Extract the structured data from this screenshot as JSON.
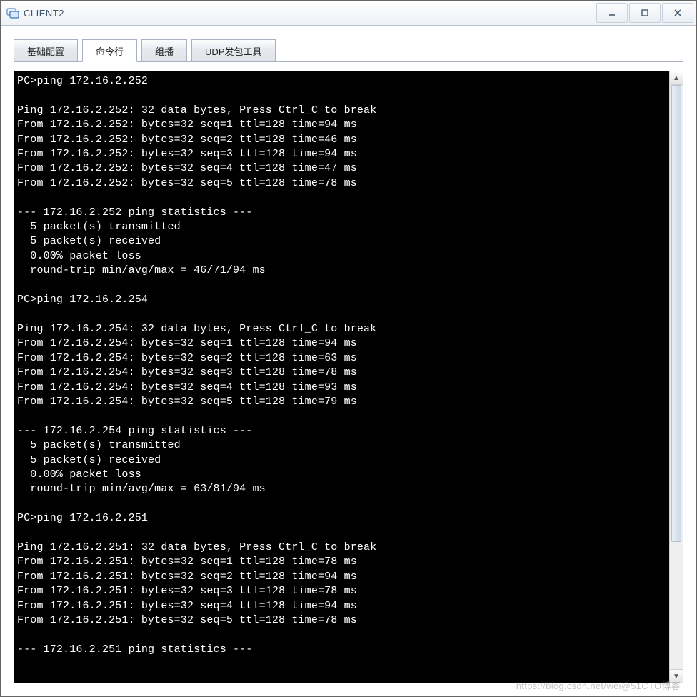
{
  "window": {
    "title": "CLIENT2"
  },
  "tabs": {
    "items": [
      {
        "label": "基础配置"
      },
      {
        "label": "命令行"
      },
      {
        "label": "组播"
      },
      {
        "label": "UDP发包工具"
      }
    ],
    "active_index": 1
  },
  "terminal": {
    "text": "PC>ping 172.16.2.252\n\nPing 172.16.2.252: 32 data bytes, Press Ctrl_C to break\nFrom 172.16.2.252: bytes=32 seq=1 ttl=128 time=94 ms\nFrom 172.16.2.252: bytes=32 seq=2 ttl=128 time=46 ms\nFrom 172.16.2.252: bytes=32 seq=3 ttl=128 time=94 ms\nFrom 172.16.2.252: bytes=32 seq=4 ttl=128 time=47 ms\nFrom 172.16.2.252: bytes=32 seq=5 ttl=128 time=78 ms\n\n--- 172.16.2.252 ping statistics ---\n  5 packet(s) transmitted\n  5 packet(s) received\n  0.00% packet loss\n  round-trip min/avg/max = 46/71/94 ms\n\nPC>ping 172.16.2.254\n\nPing 172.16.2.254: 32 data bytes, Press Ctrl_C to break\nFrom 172.16.2.254: bytes=32 seq=1 ttl=128 time=94 ms\nFrom 172.16.2.254: bytes=32 seq=2 ttl=128 time=63 ms\nFrom 172.16.2.254: bytes=32 seq=3 ttl=128 time=78 ms\nFrom 172.16.2.254: bytes=32 seq=4 ttl=128 time=93 ms\nFrom 172.16.2.254: bytes=32 seq=5 ttl=128 time=79 ms\n\n--- 172.16.2.254 ping statistics ---\n  5 packet(s) transmitted\n  5 packet(s) received\n  0.00% packet loss\n  round-trip min/avg/max = 63/81/94 ms\n\nPC>ping 172.16.2.251\n\nPing 172.16.2.251: 32 data bytes, Press Ctrl_C to break\nFrom 172.16.2.251: bytes=32 seq=1 ttl=128 time=78 ms\nFrom 172.16.2.251: bytes=32 seq=2 ttl=128 time=94 ms\nFrom 172.16.2.251: bytes=32 seq=3 ttl=128 time=78 ms\nFrom 172.16.2.251: bytes=32 seq=4 ttl=128 time=94 ms\nFrom 172.16.2.251: bytes=32 seq=5 ttl=128 time=78 ms\n\n--- 172.16.2.251 ping statistics ---"
  },
  "watermark": "https://blog.csdn.net/wei@51CTO博客"
}
